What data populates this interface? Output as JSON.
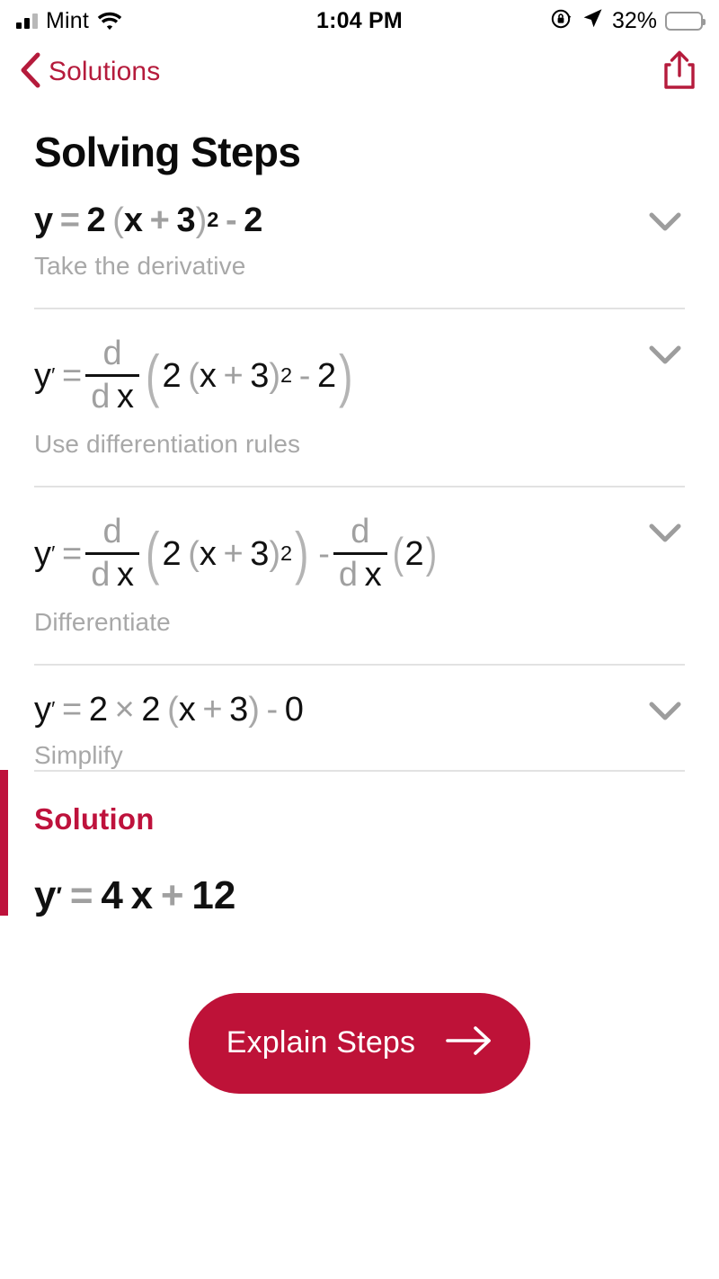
{
  "status_bar": {
    "carrier": "Mint",
    "signal_icon": "cellular-bars-icon",
    "wifi_icon": "wifi-icon",
    "time": "1:04 PM",
    "rotation_lock_icon": "rotation-lock-icon",
    "location_icon": "location-arrow-icon",
    "battery_percent": "32%",
    "battery_level": 32,
    "battery_color": "#ffcc00"
  },
  "nav": {
    "back_icon": "chevron-left-icon",
    "back_label": "Solutions",
    "share_icon": "share-icon",
    "accent_color": "#b51b3c"
  },
  "page": {
    "title": "Solving Steps"
  },
  "steps": [
    {
      "id": "step-1",
      "expression": "y = 2(x+3)^2 - 2",
      "description": "Take the derivative",
      "chevron_icon": "chevron-down-icon",
      "parts": {
        "y": "y",
        "eq": "=",
        "two": "2",
        "lpar": "(",
        "x": "x",
        "plus": "+",
        "three": "3",
        "rpar": ")",
        "exp": "2",
        "minus": "-",
        "last": "2"
      }
    },
    {
      "id": "step-2",
      "expression": "y' = d/dx (2(x+3)^2 - 2)",
      "description": "Use differentiation rules",
      "chevron_icon": "chevron-down-icon",
      "parts": {
        "y": "y",
        "prime": "′",
        "eq": "=",
        "num": "d",
        "den_d": "d",
        "den_x": "x",
        "lbig": "(",
        "two": "2",
        "lpar": "(",
        "x": "x",
        "plus": "+",
        "three": "3",
        "rpar": ")",
        "exp": "2",
        "minus": "-",
        "last": "2",
        "rbig": ")"
      }
    },
    {
      "id": "step-3",
      "expression": "y' = d/dx (2(x+3)^2) - d/dx (2)",
      "description": "Differentiate",
      "chevron_icon": "chevron-down-icon",
      "parts": {
        "y": "y",
        "prime": "′",
        "eq": "=",
        "num1": "d",
        "den1_d": "d",
        "den1_x": "x",
        "lbig1": "(",
        "two1": "2",
        "lpar": "(",
        "x": "x",
        "plus": "+",
        "three": "3",
        "rpar": ")",
        "exp": "2",
        "rbig1": ")",
        "minus": "-",
        "num2": "d",
        "den2_d": "d",
        "den2_x": "x",
        "lpar2": "(",
        "two2": "2",
        "rpar2": ")"
      }
    },
    {
      "id": "step-4",
      "expression": "y' = 2 × 2(x+3) - 0",
      "description": "Simplify",
      "chevron_icon": "chevron-down-icon",
      "parts": {
        "y": "y",
        "prime": "′",
        "eq": "=",
        "two": "2",
        "times": "×",
        "two2": "2",
        "lpar": "(",
        "x": "x",
        "plus": "+",
        "three": "3",
        "rpar": ")",
        "minus": "-",
        "zero": "0"
      }
    }
  ],
  "solution": {
    "label": "Solution",
    "expression": "y' = 4x + 12",
    "accent_color": "#be123c",
    "parts": {
      "y": "y",
      "prime": "′",
      "eq": "=",
      "four": "4",
      "x": "x",
      "plus": "+",
      "twelve": "12"
    }
  },
  "cta": {
    "label": "Explain Steps",
    "arrow_icon": "arrow-right-icon",
    "background_color": "#be1238"
  }
}
